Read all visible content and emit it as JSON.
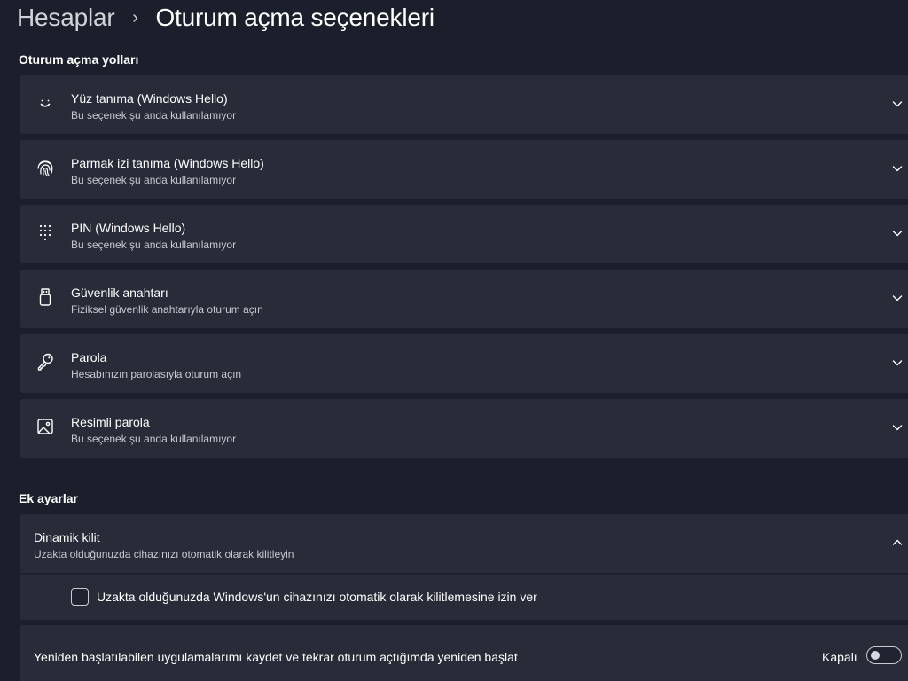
{
  "header": {
    "parent": "Hesaplar",
    "separator": "›",
    "current": "Oturum açma seçenekleri"
  },
  "sections": {
    "signin_ways": "Oturum açma yolları",
    "additional": "Ek ayarlar"
  },
  "options": [
    {
      "title": "Yüz tanıma (Windows Hello)",
      "desc": "Bu seçenek şu anda kullanılamıyor",
      "icon": "face-icon"
    },
    {
      "title": "Parmak izi tanıma (Windows Hello)",
      "desc": "Bu seçenek şu anda kullanılamıyor",
      "icon": "fingerprint-icon"
    },
    {
      "title": "PIN (Windows Hello)",
      "desc": "Bu seçenek şu anda kullanılamıyor",
      "icon": "pin-keypad-icon"
    },
    {
      "title": "Güvenlik anahtarı",
      "desc": "Fiziksel güvenlik anahtarıyla oturum açın",
      "icon": "usb-key-icon"
    },
    {
      "title": "Parola",
      "desc": "Hesabınızın parolasıyla oturum açın",
      "icon": "key-icon"
    },
    {
      "title": "Resimli parola",
      "desc": "Bu seçenek şu anda kullanılamıyor",
      "icon": "picture-icon"
    }
  ],
  "dynamic_lock": {
    "title": "Dinamik kilit",
    "desc": "Uzakta olduğunuzda cihazınızı otomatik olarak kilitleyin",
    "expanded": true,
    "checkbox_label": "Uzakta olduğunuzda Windows'un cihazınızı otomatik olarak kilitlemesine izin ver",
    "checked": false
  },
  "restart_apps": {
    "label": "Yeniden başlatılabilen uygulamalarımı kaydet ve tekrar oturum açtığımda yeniden başlat",
    "state_label": "Kapalı",
    "on": false
  },
  "colors": {
    "background": "#1a1f2b",
    "card": "#272c38",
    "text": "#ffffff",
    "secondary_text": "#c5c9d1"
  }
}
